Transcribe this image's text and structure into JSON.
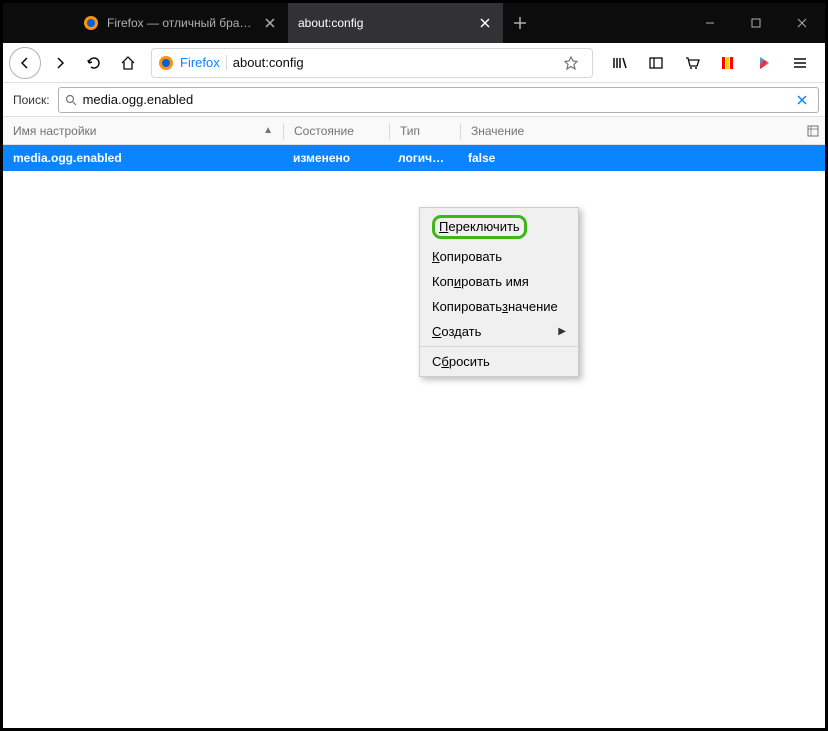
{
  "titlebar": {
    "tabs": [
      {
        "label": "Firefox — отличный браузер д",
        "active": false
      },
      {
        "label": "about:config",
        "active": true
      }
    ]
  },
  "urlbar": {
    "identity": "Firefox",
    "url": "about:config"
  },
  "search": {
    "label": "Поиск:",
    "value": "media.ogg.enabled"
  },
  "columns": {
    "name": "Имя настройки",
    "status": "Состояние",
    "type": "Тип",
    "value": "Значение"
  },
  "rows": [
    {
      "name": "media.ogg.enabled",
      "status": "изменено",
      "type": "логичес...",
      "value": "false"
    }
  ],
  "context_menu": {
    "items": [
      {
        "label_pre": "",
        "accel": "П",
        "label_post": "ереключить",
        "highlighted": true
      },
      {
        "label_pre": "",
        "accel": "К",
        "label_post": "опировать"
      },
      {
        "label_pre": "Коп",
        "accel": "и",
        "label_post": "ровать имя"
      },
      {
        "label_pre": "Копировать ",
        "accel": "з",
        "label_post": "начение"
      },
      {
        "label_pre": "",
        "accel": "С",
        "label_post": "оздать",
        "submenu": true
      },
      {
        "label_pre": "С",
        "accel": "б",
        "label_post": "росить"
      }
    ]
  }
}
